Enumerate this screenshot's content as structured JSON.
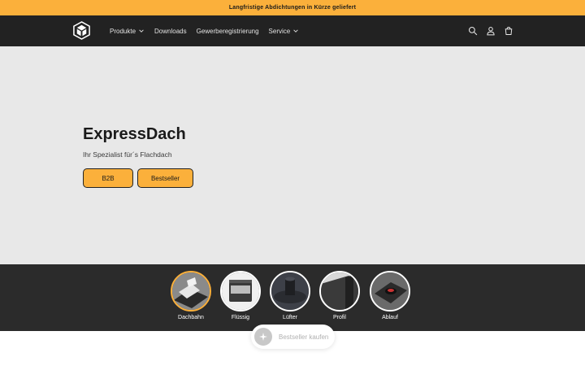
{
  "announcement": {
    "text": "Langfristige Abdichtungen in Kürze geliefert"
  },
  "nav": {
    "items": [
      {
        "label": "Produkte",
        "has_dropdown": true
      },
      {
        "label": "Downloads",
        "has_dropdown": false
      },
      {
        "label": "Gewerberegistrierung",
        "has_dropdown": false
      },
      {
        "label": "Service",
        "has_dropdown": true
      }
    ]
  },
  "header_icons": [
    "search-icon",
    "account-icon",
    "cart-icon"
  ],
  "hero": {
    "title": "ExpressDach",
    "subtitle": "Ihr Spezialist für´s Flachdach",
    "buttons": [
      {
        "label": "B2B"
      },
      {
        "label": "Bestseller"
      }
    ]
  },
  "categories": [
    {
      "label": "Dachbahn",
      "active": true
    },
    {
      "label": "Flüssig",
      "active": false
    },
    {
      "label": "Lüfter",
      "active": false
    },
    {
      "label": "Profil",
      "active": false
    },
    {
      "label": "Ablauf",
      "active": false
    }
  ],
  "floating_button": {
    "label": "Bestseller kaufen"
  },
  "colors": {
    "accent": "#fbb03b",
    "header_bg": "#222222",
    "hero_bg": "#e8e8e8",
    "category_bg": "#2b2b2b"
  }
}
